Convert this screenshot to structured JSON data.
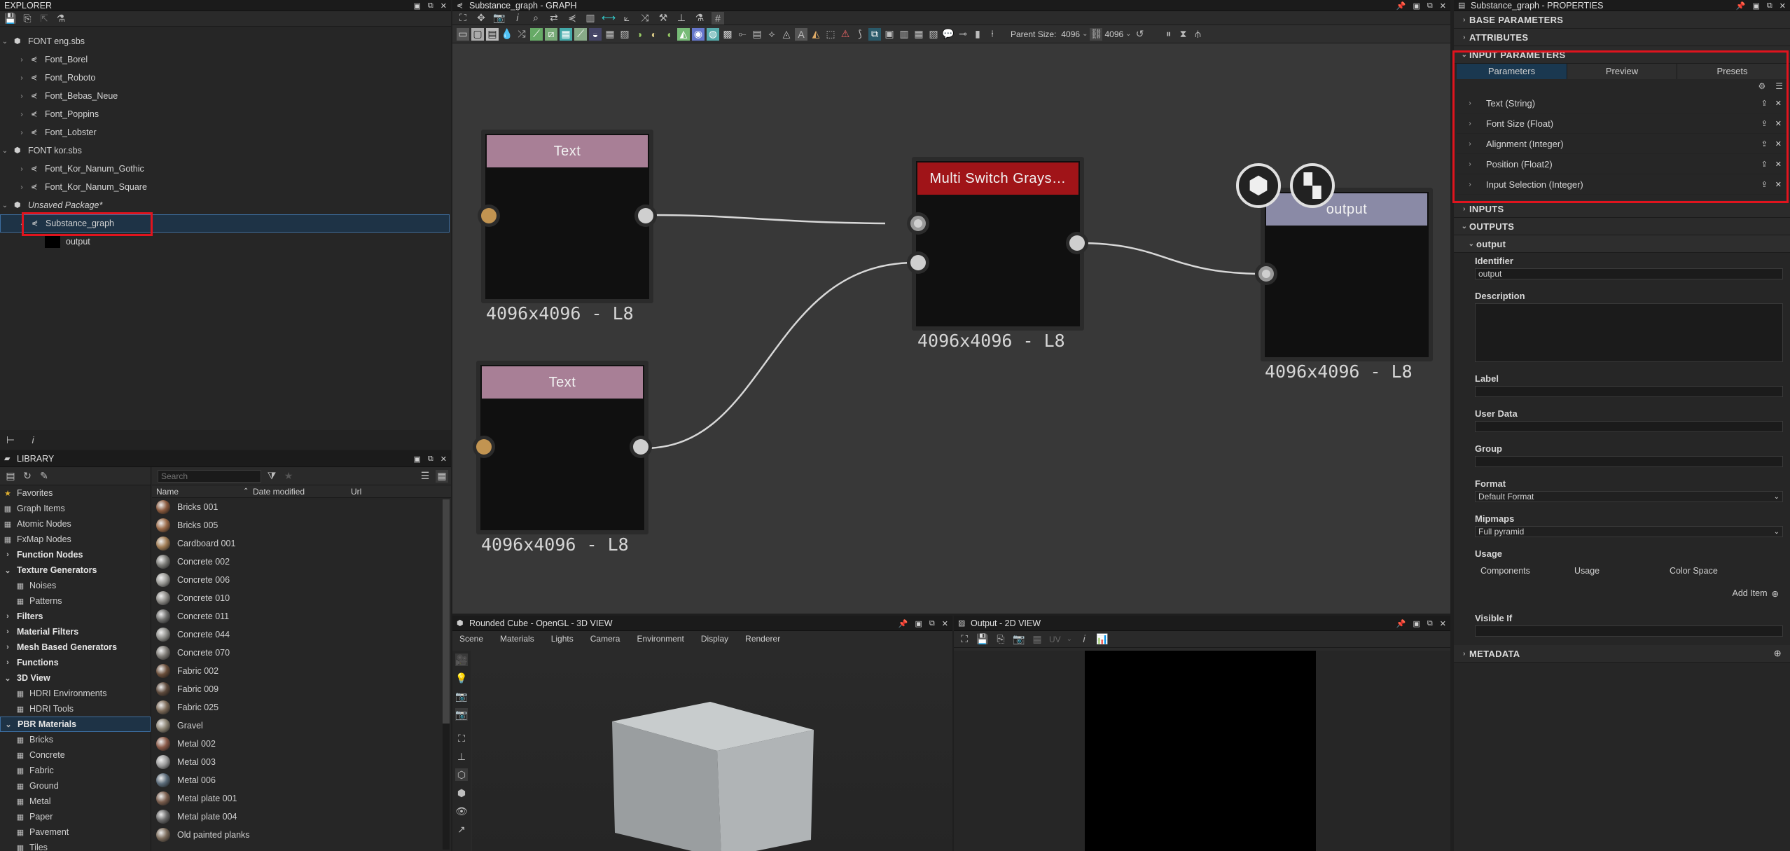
{
  "explorer": {
    "title": "EXPLORER",
    "packages": [
      {
        "name": "FONT eng.sbs",
        "graphs": [
          "Font_Borel",
          "Font_Roboto",
          "Font_Bebas_Neue",
          "Font_Poppins",
          "Font_Lobster"
        ]
      },
      {
        "name": "FONT kor.sbs",
        "graphs": [
          "Font_Kor_Nanum_Gothic",
          "Font_Kor_Nanum_Square"
        ]
      },
      {
        "name": "Unsaved Package*",
        "graphs": [
          "Substance_graph"
        ],
        "child": "output"
      }
    ]
  },
  "library": {
    "title": "LIBRARY",
    "search_placeholder": "Search",
    "columns": [
      "Name",
      "Date modified",
      "Url"
    ],
    "categories": [
      {
        "label": "Favorites",
        "level": 0,
        "bold": false
      },
      {
        "label": "Graph Items",
        "level": 0,
        "bold": false
      },
      {
        "label": "Atomic Nodes",
        "level": 0,
        "bold": false
      },
      {
        "label": "FxMap Nodes",
        "level": 0,
        "bold": false
      },
      {
        "label": "Function Nodes",
        "level": 0,
        "bold": true
      },
      {
        "label": "Texture Generators",
        "level": 0,
        "bold": true
      },
      {
        "label": "Noises",
        "level": 1,
        "bold": false
      },
      {
        "label": "Patterns",
        "level": 1,
        "bold": false
      },
      {
        "label": "Filters",
        "level": 0,
        "bold": true
      },
      {
        "label": "Material Filters",
        "level": 0,
        "bold": true
      },
      {
        "label": "Mesh Based Generators",
        "level": 0,
        "bold": true
      },
      {
        "label": "Functions",
        "level": 0,
        "bold": true
      },
      {
        "label": "3D View",
        "level": 0,
        "bold": true
      },
      {
        "label": "HDRI Environments",
        "level": 1,
        "bold": false
      },
      {
        "label": "HDRI Tools",
        "level": 1,
        "bold": false
      },
      {
        "label": "PBR Materials",
        "level": 0,
        "bold": true
      },
      {
        "label": "Bricks",
        "level": 1,
        "bold": false
      },
      {
        "label": "Concrete",
        "level": 1,
        "bold": false
      },
      {
        "label": "Fabric",
        "level": 1,
        "bold": false
      },
      {
        "label": "Ground",
        "level": 1,
        "bold": false
      },
      {
        "label": "Metal",
        "level": 1,
        "bold": false
      },
      {
        "label": "Paper",
        "level": 1,
        "bold": false
      },
      {
        "label": "Pavement",
        "level": 1,
        "bold": false
      },
      {
        "label": "Tiles",
        "level": 1,
        "bold": false
      }
    ],
    "items": [
      {
        "name": "Bricks 001",
        "color": "#8a5a3e"
      },
      {
        "name": "Bricks 005",
        "color": "#9a6a48"
      },
      {
        "name": "Cardboard 001",
        "color": "#a07c54"
      },
      {
        "name": "Concrete 002",
        "color": "#7a7a76"
      },
      {
        "name": "Concrete 006",
        "color": "#9a9a96"
      },
      {
        "name": "Concrete 010",
        "color": "#8c8a86"
      },
      {
        "name": "Concrete 011",
        "color": "#6e6e6c"
      },
      {
        "name": "Concrete 044",
        "color": "#8e8e8a"
      },
      {
        "name": "Concrete 070",
        "color": "#7e7b76"
      },
      {
        "name": "Fabric 002",
        "color": "#6a4e3a"
      },
      {
        "name": "Fabric 009",
        "color": "#5e4a3c"
      },
      {
        "name": "Fabric 025",
        "color": "#7c6a58"
      },
      {
        "name": "Gravel",
        "color": "#8a8272"
      },
      {
        "name": "Metal 002",
        "color": "#8a5a48"
      },
      {
        "name": "Metal 003",
        "color": "#9c9c9c"
      },
      {
        "name": "Metal 006",
        "color": "#5a6a78"
      },
      {
        "name": "Metal plate 001",
        "color": "#7a5e4e"
      },
      {
        "name": "Metal plate 004",
        "color": "#6a6a6a"
      },
      {
        "name": "Old painted planks",
        "color": "#7a6a5a"
      }
    ]
  },
  "graph": {
    "title": "Substance_graph - GRAPH",
    "parent_size_label": "Parent Size:",
    "parent_size_value": "4096",
    "size_value": "4096",
    "nodes": {
      "text1": {
        "title": "Text",
        "size": "4096x4096 - L8"
      },
      "text2": {
        "title": "Text",
        "size": "4096x4096 - L8"
      },
      "switch": {
        "title": "Multi Switch Grays…",
        "size": "4096x4096 - L8"
      },
      "output": {
        "title": "output",
        "size": "4096x4096 - L8"
      }
    }
  },
  "view3d": {
    "title": "Rounded Cube - OpenGL - 3D VIEW",
    "menu": [
      "Scene",
      "Materials",
      "Lights",
      "Camera",
      "Environment",
      "Display",
      "Renderer"
    ]
  },
  "view2d": {
    "title": "Output - 2D VIEW",
    "uv_label": "UV"
  },
  "properties": {
    "title": "Substance_graph - PROPERTIES",
    "sections": {
      "base": "BASE PARAMETERS",
      "attributes": "ATTRIBUTES",
      "input": "INPUT PARAMETERS",
      "inputs": "INPUTS",
      "outputs": "OUTPUTS",
      "metadata": "METADATA"
    },
    "tabs": [
      "Parameters",
      "Preview",
      "Presets"
    ],
    "params": [
      "Text (String)",
      "Font Size (Float)",
      "Alignment (Integer)",
      "Position (Float2)",
      "Input Selection (Integer)"
    ],
    "output": {
      "name": "output",
      "identifier_label": "Identifier",
      "identifier_value": "output",
      "description_label": "Description",
      "label_label": "Label",
      "user_data_label": "User Data",
      "group_label": "Group",
      "format_label": "Format",
      "format_value": "Default Format",
      "mipmaps_label": "Mipmaps",
      "mipmaps_value": "Full pyramid",
      "usage_label": "Usage",
      "usage_columns": [
        "Components",
        "Usage",
        "Color Space"
      ],
      "add_item": "Add Item",
      "visible_if_label": "Visible If"
    }
  }
}
